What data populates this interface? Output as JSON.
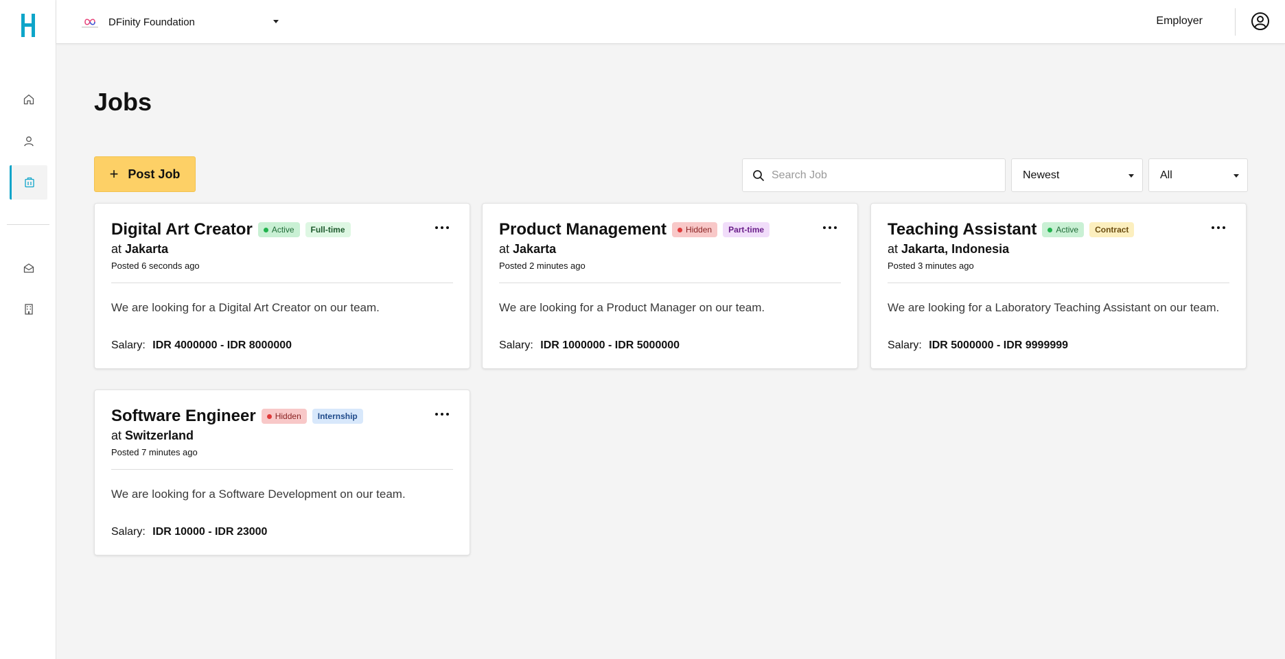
{
  "app": {
    "logo_letter": "H",
    "org_name": "DFinity Foundation",
    "role": "Employer"
  },
  "sidebar": {
    "items": [
      {
        "name": "home-icon",
        "active": false
      },
      {
        "name": "user-icon",
        "active": false
      },
      {
        "name": "briefcase-icon",
        "active": true
      },
      {
        "name": "mail-open-icon",
        "active": false
      },
      {
        "name": "building-icon",
        "active": false
      }
    ]
  },
  "page": {
    "title": "Jobs",
    "post_button": "Post Job",
    "search_placeholder": "Search Job",
    "sort_value": "Newest",
    "filter_value": "All"
  },
  "jobs": [
    {
      "title": "Digital Art Creator",
      "status": "Active",
      "type": "Full-time",
      "at_prefix": "at",
      "location": "Jakarta",
      "posted": "Posted 6 seconds ago",
      "description": "We are looking for a Digital Art Creator on our team.",
      "salary_label": "Salary:",
      "salary": "IDR 4000000 - IDR 8000000"
    },
    {
      "title": "Product Management",
      "status": "Hidden",
      "type": "Part-time",
      "at_prefix": "at",
      "location": "Jakarta",
      "posted": "Posted 2 minutes ago",
      "description": "We are looking for a Product Manager on our team.",
      "salary_label": "Salary:",
      "salary": "IDR 1000000 - IDR 5000000"
    },
    {
      "title": "Teaching Assistant",
      "status": "Active",
      "type": "Contract",
      "at_prefix": "at",
      "location": "Jakarta, Indonesia",
      "posted": "Posted 3 minutes ago",
      "description": "We are looking for a Laboratory Teaching Assistant on our team.",
      "salary_label": "Salary:",
      "salary": "IDR 5000000 - IDR 9999999"
    },
    {
      "title": "Software Engineer",
      "status": "Hidden",
      "type": "Internship",
      "at_prefix": "at",
      "location": "Switzerland",
      "posted": "Posted 7 minutes ago",
      "description": "We are looking for a Software Development on our team.",
      "salary_label": "Salary:",
      "salary": "IDR 10000 - IDR 23000"
    }
  ],
  "colors": {
    "accent": "#0ea5c9",
    "post_button": "#fdd066",
    "active_badge": "#c9f0d4",
    "hidden_badge": "#f8c8c8"
  }
}
